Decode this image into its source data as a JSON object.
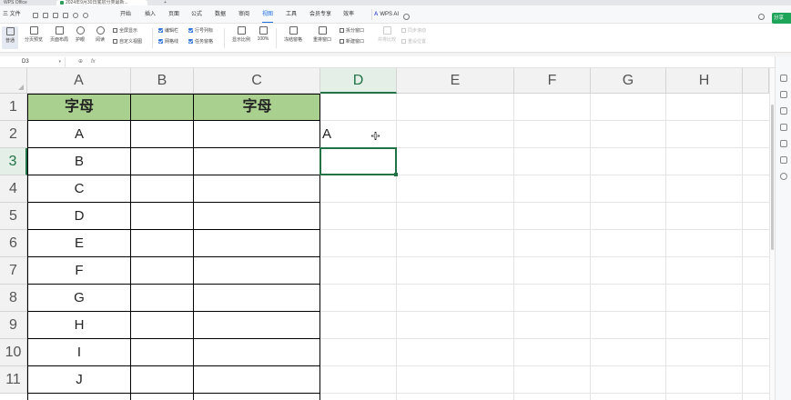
{
  "titlebar": {
    "app_tab": "WPS Office",
    "doc_tab": "2024年9月30日底层分类最新...",
    "new_tab": "+"
  },
  "menu": {
    "file": "三 文件",
    "items": [
      "开始",
      "插入",
      "页面",
      "公式",
      "数据",
      "审阅",
      "视图",
      "工具",
      "会员专享",
      "效率"
    ],
    "active": "视图",
    "wps_ai": "WPS AI",
    "share": "分享"
  },
  "ribbon": {
    "normal": "普通",
    "page_break": "分页预览",
    "page_layout": "页面布局",
    "eye_protect": "护眼",
    "reading": "阅读",
    "fullscreen": "全屏显示",
    "custom_view": "自定义视图",
    "edit_bar": "编辑栏",
    "gridlines": "网格线",
    "headings": "行号列标",
    "task_pane": "任务窗格",
    "zoom": "显示比例",
    "zoom_100": "100%",
    "freeze": "冻结窗格",
    "arrange": "重排窗口",
    "split": "拆分窗口",
    "new_window": "新建窗口",
    "side_by_side": "并排比较",
    "sync_scroll": "同步滚动",
    "reset_pos": "重设位置"
  },
  "formula_bar": {
    "cell_ref": "D3",
    "formula": ""
  },
  "grid": {
    "columns": [
      "A",
      "B",
      "C",
      "D",
      "E",
      "F",
      "G",
      "H"
    ],
    "rows": [
      "1",
      "2",
      "3",
      "4",
      "5",
      "6",
      "7",
      "8",
      "9",
      "10",
      "11"
    ],
    "selected_cell": "D3",
    "a1_header": "字母",
    "c1_header": "字母",
    "col_a_values": [
      "A",
      "B",
      "C",
      "D",
      "E",
      "F",
      "G",
      "H",
      "I",
      "J"
    ],
    "d2_value": "A"
  },
  "colors": {
    "header_fill": "#a9d08e",
    "accent": "#217346",
    "menu_active": "#1d6fe0"
  }
}
